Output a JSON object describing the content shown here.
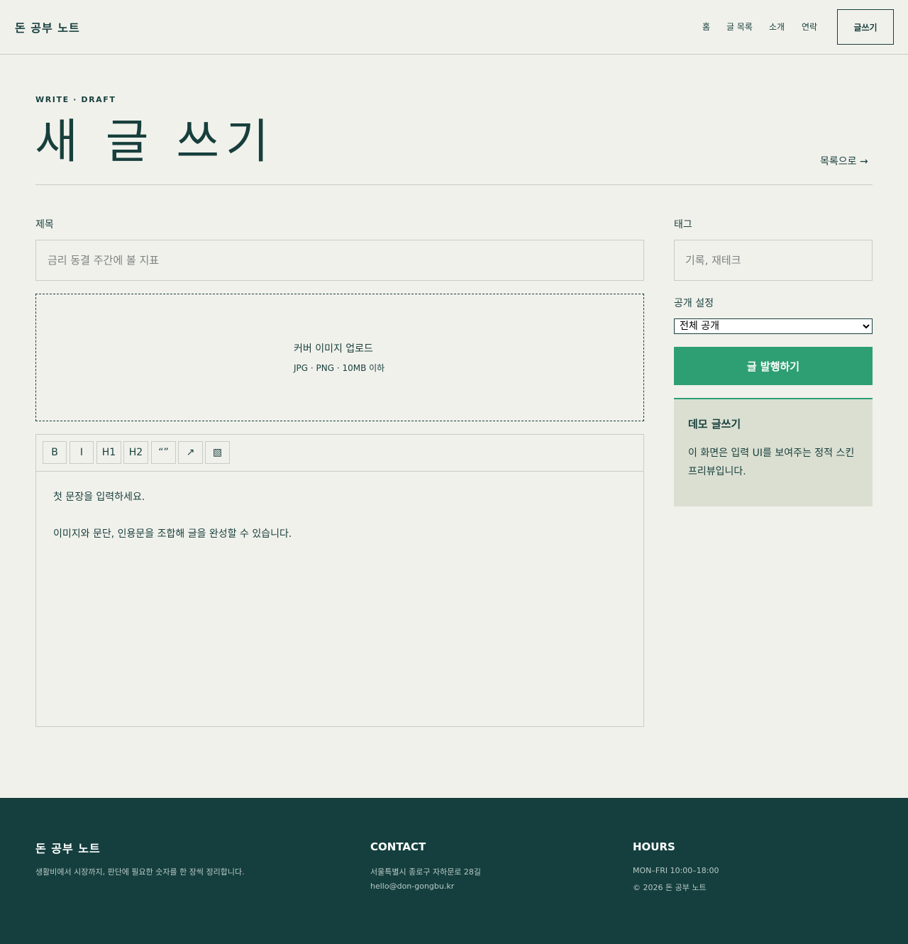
{
  "header": {
    "brand": "돈 공부 노트",
    "nav": [
      "홈",
      "글 목록",
      "소개",
      "연락"
    ],
    "write_button": "글쓰기"
  },
  "page": {
    "eyebrow": "WRITE · DRAFT",
    "title": "새 글 쓰기",
    "back_link": "목록으로 →"
  },
  "form": {
    "title_label": "제목",
    "title_placeholder": "금리 동결 주간에 볼 지표",
    "upload_title": "커버 이미지 업로드",
    "upload_hint": "JPG · PNG · 10MB 이하",
    "toolbar": [
      "B",
      "I",
      "H1",
      "H2",
      "“”",
      "↗",
      "▧"
    ],
    "body_lines": [
      "첫 문장을 입력하세요.",
      "이미지와 문단, 인용문을 조합해 글을 완성할 수 있습니다."
    ]
  },
  "sidebar": {
    "tag_label": "태그",
    "tag_placeholder": "기록, 재테크",
    "visibility_label": "공개 설정",
    "visibility_value": "전체 공개",
    "publish_button": "글 발행하기",
    "notice_title": "데모 글쓰기",
    "notice_text": "이 화면은 입력 UI를 보여주는 정적 스킨 프리뷰입니다."
  },
  "footer": {
    "brand": "돈 공부 노트",
    "description": "생활비에서 시장까지, 판단에 필요한 숫자를 한 장씩 정리합니다.",
    "contact_heading": "CONTACT",
    "address": "서울특별시 종로구 자하문로 28길",
    "email": "hello@don-gongbu.kr",
    "hours_heading": "HOURS",
    "hours": "MON–FRI 10:00–18:00",
    "copyright": "© 2026 돈 공부 노트"
  },
  "colors": {
    "background": "#f1f1ec",
    "ink": "#173f3c",
    "accent": "#2e9f72",
    "footer": "#143f3e",
    "notice": "#dadfd1"
  }
}
